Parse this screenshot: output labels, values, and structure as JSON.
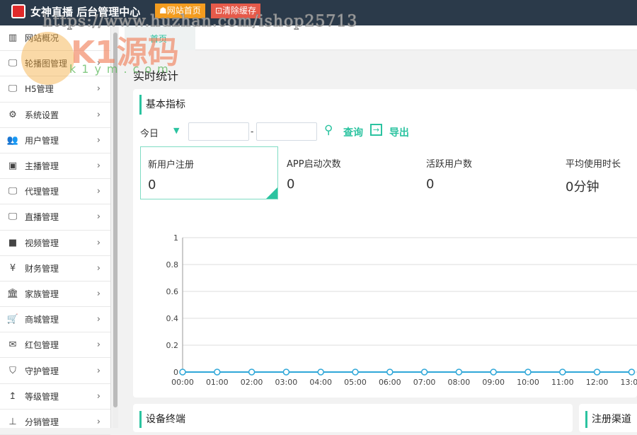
{
  "header": {
    "title": "女神直播 后台管理中心",
    "btn_home": "☗网站首页",
    "btn_clear": "⊡清除缓存"
  },
  "watermark": {
    "url": "https://www.huzhan.com/ishop25713",
    "brand": "K1源码",
    "domain": "k1ym.com"
  },
  "sidebar": {
    "items": [
      {
        "label": "网站概况",
        "icon": "bar-chart-icon"
      },
      {
        "label": "轮播图管理",
        "icon": "monitor-icon"
      },
      {
        "label": "H5管理",
        "icon": "monitor-icon"
      },
      {
        "label": "系统设置",
        "icon": "gears-icon"
      },
      {
        "label": "用户管理",
        "icon": "users-icon"
      },
      {
        "label": "主播管理",
        "icon": "badge-icon"
      },
      {
        "label": "代理管理",
        "icon": "monitor-icon"
      },
      {
        "label": "直播管理",
        "icon": "monitor-icon"
      },
      {
        "label": "视频管理",
        "icon": "video-icon"
      },
      {
        "label": "财务管理",
        "icon": "yen-icon"
      },
      {
        "label": "家族管理",
        "icon": "bank-icon"
      },
      {
        "label": "商城管理",
        "icon": "cart-icon"
      },
      {
        "label": "红包管理",
        "icon": "envelope-icon"
      },
      {
        "label": "守护管理",
        "icon": "shield-icon"
      },
      {
        "label": "等级管理",
        "icon": "arrow-up-icon"
      },
      {
        "label": "分销管理",
        "icon": "sitemap-icon"
      }
    ]
  },
  "tabs": {
    "home": "首页"
  },
  "main": {
    "title": "实时统计",
    "section": "基本指标",
    "period": "今日",
    "date_sep": "-",
    "query": "查询",
    "export": "导出",
    "stats": [
      {
        "label": "新用户注册",
        "value": "0"
      },
      {
        "label": "APP启动次数",
        "value": "0"
      },
      {
        "label": "活跃用户数",
        "value": "0"
      },
      {
        "label": "平均使用时长",
        "value": "0分钟"
      }
    ],
    "bottom_left": "设备终端",
    "bottom_right": "注册渠道"
  },
  "chart_data": {
    "type": "line",
    "x": [
      "00:00",
      "01:00",
      "02:00",
      "03:00",
      "04:00",
      "05:00",
      "06:00",
      "07:00",
      "08:00",
      "09:00",
      "10:00",
      "11:00",
      "12:00",
      "13:00"
    ],
    "values": [
      0,
      0,
      0,
      0,
      0,
      0,
      0,
      0,
      0,
      0,
      0,
      0,
      0,
      0
    ],
    "ylim": [
      0,
      1
    ],
    "yticks": [
      "0",
      "0.2",
      "0.4",
      "0.6",
      "0.8",
      "1"
    ],
    "color": "#2fa7d8",
    "grid": true
  }
}
